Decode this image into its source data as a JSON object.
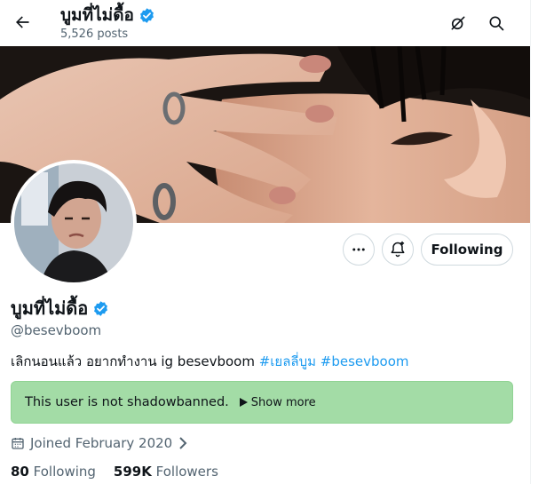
{
  "header": {
    "display_name": "บูมที่ไม่ดื้อ",
    "posts_count": "5,526 posts",
    "back_icon": "arrow-left-icon",
    "grok_icon": "grok-icon",
    "search_icon": "search-icon"
  },
  "profile": {
    "display_name": "บูมที่ไม่ดื้อ",
    "handle": "@besevboom",
    "bio_text": "เลิกนอนแล้ว อยากทำงาน ig besevboom ",
    "bio_tags": [
      "#เยลลี่บูม",
      "#besevboom"
    ],
    "joined": "Joined February 2020",
    "following_count": "80",
    "following_label": "Following",
    "followers_count": "599K",
    "followers_label": "Followers"
  },
  "actions": {
    "more_icon": "more-dots-icon",
    "notify_icon": "bell-plus-icon",
    "follow_label": "Following"
  },
  "notice": {
    "text": "This user is not shadowbanned.",
    "show_more": "Show more"
  },
  "colors": {
    "accent": "#1d9bf0",
    "notice_bg": "#a3dca6",
    "muted": "#536471"
  }
}
